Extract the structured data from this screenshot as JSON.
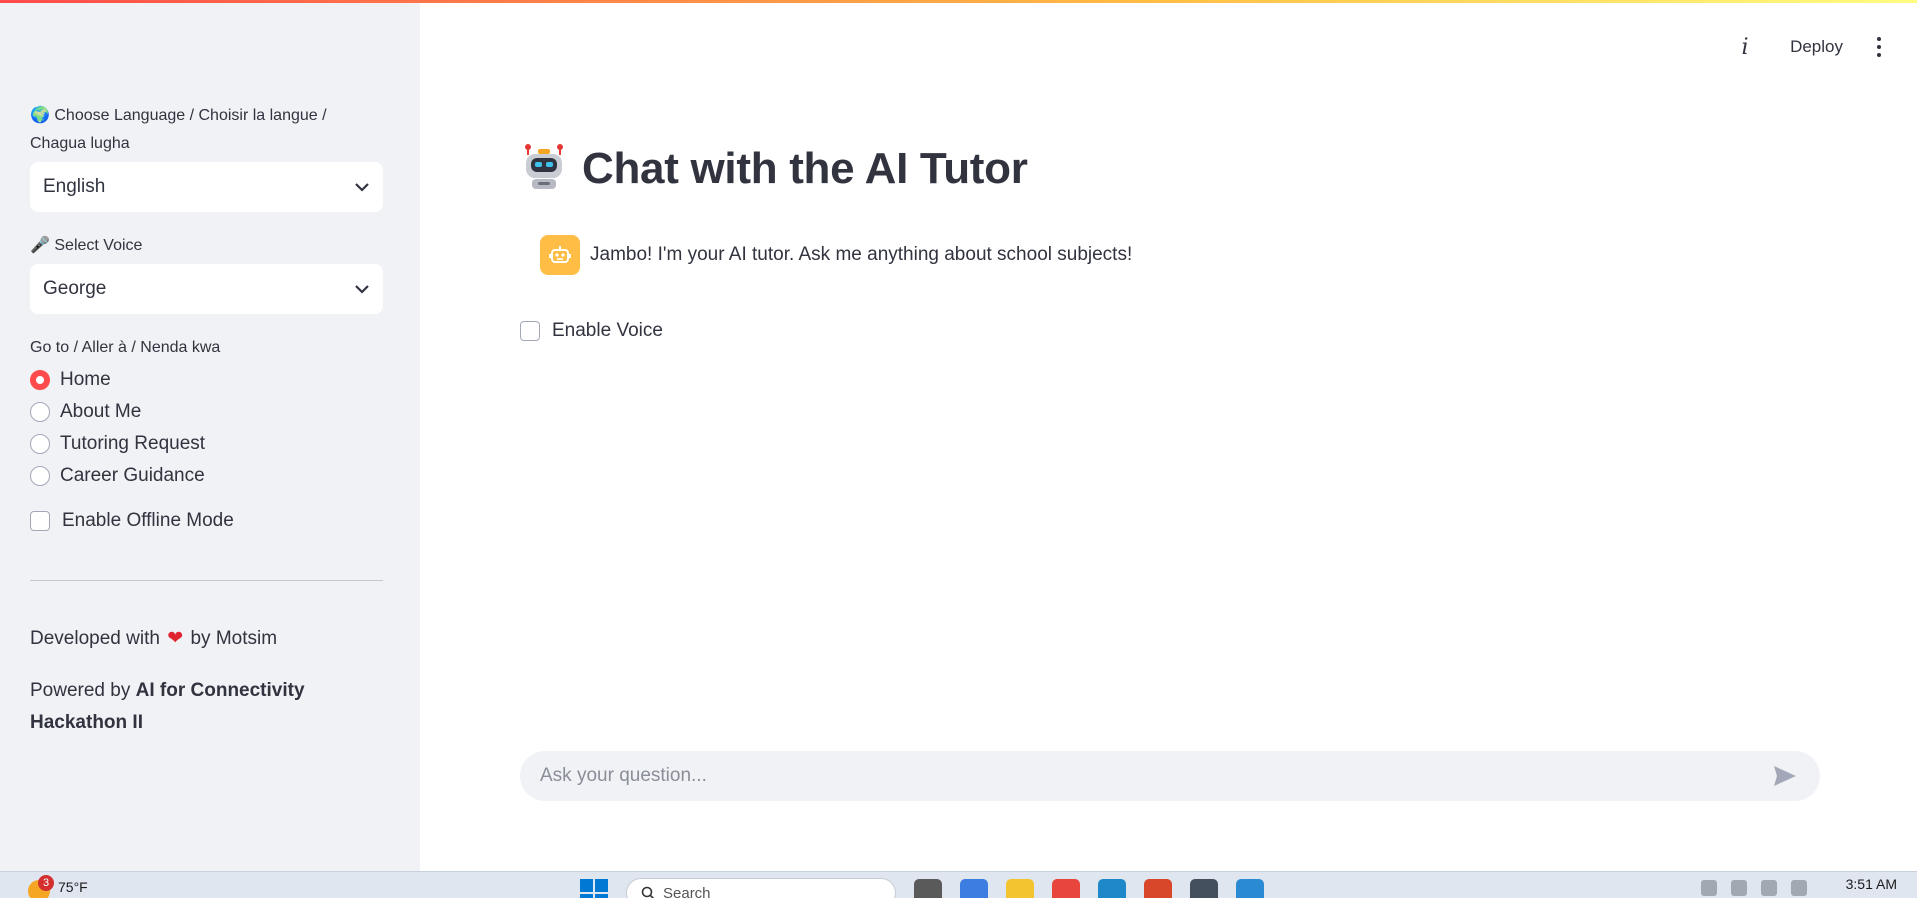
{
  "sidebar": {
    "language_label": "Choose Language / Choisir la langue / Chagua lugha",
    "language_icon": "globe-icon",
    "language_value": "English",
    "voice_label": "Select Voice",
    "voice_icon": "microphone-icon",
    "voice_value": "George",
    "nav_label": "Go to / Aller à / Nenda kwa",
    "nav_items": [
      {
        "label": "Home",
        "selected": true
      },
      {
        "label": "About Me",
        "selected": false
      },
      {
        "label": "Tutoring Request",
        "selected": false
      },
      {
        "label": "Career Guidance",
        "selected": false
      }
    ],
    "offline_label": "Enable Offline Mode",
    "developed_prefix": "Developed with",
    "developed_suffix": "by Motsim",
    "powered_prefix": "Powered by",
    "powered_bold": "AI for Connectivity Hackathon II"
  },
  "toolbar": {
    "info_icon": "info-icon",
    "deploy_label": "Deploy",
    "menu_icon": "more-vertical-icon"
  },
  "main": {
    "title": "Chat with the AI Tutor",
    "title_icon": "robot-icon",
    "assistant_message": "Jambo! I'm your AI tutor. Ask me anything about school subjects!",
    "enable_voice_label": "Enable Voice",
    "chat_placeholder": "Ask your question..."
  },
  "taskbar": {
    "weather_badge": "3",
    "weather_temp": "75°F",
    "search_text": "Search",
    "time": "3:51 AM"
  },
  "colors": {
    "accent": "#ff4b4b",
    "sidebar_bg": "#f0f2f6",
    "avatar_bg": "#ffbd45"
  }
}
